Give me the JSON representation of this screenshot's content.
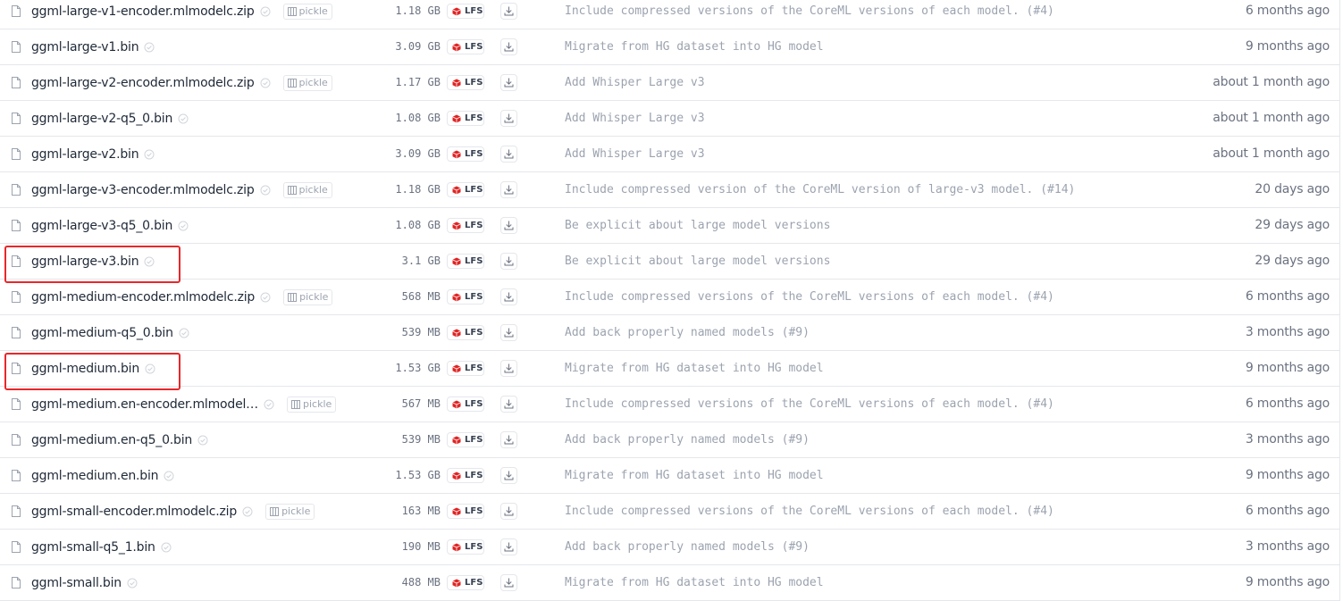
{
  "files": [
    {
      "name": "ggml-large-v1-encoder.mlmodelc.zip",
      "pickle": true,
      "size": "1.18 GB",
      "commit": "Include compressed versions of the CoreML versions of each model. (#4)",
      "date": "6 months ago"
    },
    {
      "name": "ggml-large-v1.bin",
      "pickle": false,
      "size": "3.09 GB",
      "commit": "Migrate from HG dataset into HG model",
      "date": "9 months ago"
    },
    {
      "name": "ggml-large-v2-encoder.mlmodelc.zip",
      "pickle": true,
      "size": "1.17 GB",
      "commit": "Add Whisper Large v3",
      "date": "about 1 month ago"
    },
    {
      "name": "ggml-large-v2-q5_0.bin",
      "pickle": false,
      "size": "1.08 GB",
      "commit": "Add Whisper Large v3",
      "date": "about 1 month ago"
    },
    {
      "name": "ggml-large-v2.bin",
      "pickle": false,
      "size": "3.09 GB",
      "commit": "Add Whisper Large v3",
      "date": "about 1 month ago"
    },
    {
      "name": "ggml-large-v3-encoder.mlmodelc.zip",
      "pickle": true,
      "size": "1.18 GB",
      "commit": "Include compressed version of the CoreML version of large-v3 model. (#14)",
      "date": "20 days ago"
    },
    {
      "name": "ggml-large-v3-q5_0.bin",
      "pickle": false,
      "size": "1.08 GB",
      "commit": "Be explicit about large model versions",
      "date": "29 days ago"
    },
    {
      "name": "ggml-large-v3.bin",
      "pickle": false,
      "size": "3.1 GB",
      "commit": "Be explicit about large model versions",
      "date": "29 days ago",
      "highlighted": true
    },
    {
      "name": "ggml-medium-encoder.mlmodelc.zip",
      "pickle": true,
      "size": "568 MB",
      "commit": "Include compressed versions of the CoreML versions of each model. (#4)",
      "date": "6 months ago"
    },
    {
      "name": "ggml-medium-q5_0.bin",
      "pickle": false,
      "size": "539 MB",
      "commit": "Add back properly named models (#9)",
      "date": "3 months ago"
    },
    {
      "name": "ggml-medium.bin",
      "pickle": false,
      "size": "1.53 GB",
      "commit": "Migrate from HG dataset into HG model",
      "date": "9 months ago",
      "highlighted": true
    },
    {
      "name": "ggml-medium.en-encoder.mlmodel…",
      "pickle": true,
      "size": "567 MB",
      "commit": "Include compressed versions of the CoreML versions of each model. (#4)",
      "date": "6 months ago"
    },
    {
      "name": "ggml-medium.en-q5_0.bin",
      "pickle": false,
      "size": "539 MB",
      "commit": "Add back properly named models (#9)",
      "date": "3 months ago"
    },
    {
      "name": "ggml-medium.en.bin",
      "pickle": false,
      "size": "1.53 GB",
      "commit": "Migrate from HG dataset into HG model",
      "date": "9 months ago"
    },
    {
      "name": "ggml-small-encoder.mlmodelc.zip",
      "pickle": true,
      "size": "163 MB",
      "commit": "Include compressed versions of the CoreML versions of each model. (#4)",
      "date": "6 months ago"
    },
    {
      "name": "ggml-small-q5_1.bin",
      "pickle": false,
      "size": "190 MB",
      "commit": "Add back properly named models (#9)",
      "date": "3 months ago"
    },
    {
      "name": "ggml-small.bin",
      "pickle": false,
      "size": "488 MB",
      "commit": "Migrate from HG dataset into HG model",
      "date": "9 months ago"
    }
  ],
  "labels": {
    "lfs": "LFS",
    "pickle": "pickle"
  },
  "icons": {
    "file": "file-icon",
    "safe": "shield-check-icon",
    "lfs": "lfs-cube-icon",
    "download": "download-icon",
    "pickle": "pickle-icon"
  },
  "colors": {
    "highlight": "#e8272a",
    "lfs_cube": "#e02424"
  }
}
